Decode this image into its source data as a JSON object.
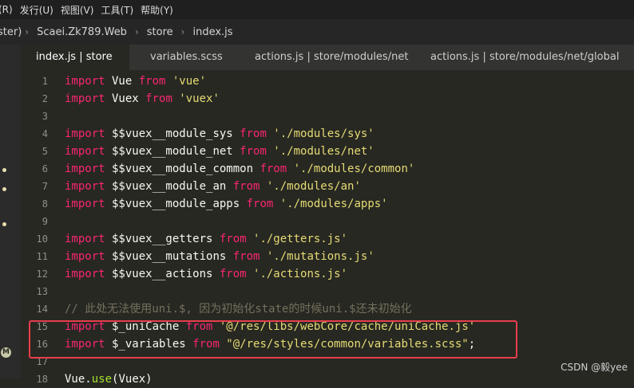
{
  "menu": [
    "(R)",
    "发行(U)",
    "视图(V)",
    "工具(T)",
    "帮助(Y)"
  ],
  "breadcrumb": [
    "ster)",
    "Scaei.Zk789.Web",
    "store",
    "index.js"
  ],
  "tabs": [
    {
      "label": "index.js | store",
      "active": true
    },
    {
      "label": "variables.scss",
      "active": false
    },
    {
      "label": "actions.js | store/modules/net",
      "active": false
    },
    {
      "label": "actions.js | store/modules/net/global",
      "active": false
    }
  ],
  "code": [
    {
      "n": "1",
      "tokens": [
        {
          "t": "import",
          "c": "kw"
        },
        {
          "t": " Vue ",
          "c": ""
        },
        {
          "t": "from",
          "c": "kw"
        },
        {
          "t": " 'vue'",
          "c": "str"
        }
      ]
    },
    {
      "n": "2",
      "tokens": [
        {
          "t": "import",
          "c": "kw"
        },
        {
          "t": " Vuex ",
          "c": ""
        },
        {
          "t": "from",
          "c": "kw"
        },
        {
          "t": " 'vuex'",
          "c": "str"
        }
      ]
    },
    {
      "n": "3",
      "tokens": []
    },
    {
      "n": "4",
      "tokens": [
        {
          "t": "import",
          "c": "kw"
        },
        {
          "t": " $$vuex__module_sys ",
          "c": ""
        },
        {
          "t": "from",
          "c": "kw"
        },
        {
          "t": " './modules/sys'",
          "c": "str"
        }
      ]
    },
    {
      "n": "5",
      "tokens": [
        {
          "t": "import",
          "c": "kw"
        },
        {
          "t": " $$vuex__module_net ",
          "c": ""
        },
        {
          "t": "from",
          "c": "kw"
        },
        {
          "t": " './modules/net'",
          "c": "str"
        }
      ]
    },
    {
      "n": "6",
      "tokens": [
        {
          "t": "import",
          "c": "kw"
        },
        {
          "t": " $$vuex__module_common ",
          "c": ""
        },
        {
          "t": "from",
          "c": "kw"
        },
        {
          "t": " './modules/common'",
          "c": "str"
        }
      ]
    },
    {
      "n": "7",
      "tokens": [
        {
          "t": "import",
          "c": "kw"
        },
        {
          "t": " $$vuex__module_an ",
          "c": ""
        },
        {
          "t": "from",
          "c": "kw"
        },
        {
          "t": " './modules/an'",
          "c": "str"
        }
      ]
    },
    {
      "n": "8",
      "tokens": [
        {
          "t": "import",
          "c": "kw"
        },
        {
          "t": " $$vuex__module_apps ",
          "c": ""
        },
        {
          "t": "from",
          "c": "kw"
        },
        {
          "t": " './modules/apps'",
          "c": "str"
        }
      ]
    },
    {
      "n": "9",
      "tokens": []
    },
    {
      "n": "10",
      "tokens": [
        {
          "t": "import",
          "c": "kw"
        },
        {
          "t": " $$vuex__getters ",
          "c": ""
        },
        {
          "t": "from",
          "c": "kw"
        },
        {
          "t": " './getters.js'",
          "c": "str"
        }
      ]
    },
    {
      "n": "11",
      "tokens": [
        {
          "t": "import",
          "c": "kw"
        },
        {
          "t": " $$vuex__mutations ",
          "c": ""
        },
        {
          "t": "from",
          "c": "kw"
        },
        {
          "t": " './mutations.js'",
          "c": "str"
        }
      ]
    },
    {
      "n": "12",
      "tokens": [
        {
          "t": "import",
          "c": "kw"
        },
        {
          "t": " $$vuex__actions ",
          "c": ""
        },
        {
          "t": "from",
          "c": "kw"
        },
        {
          "t": " './actions.js'",
          "c": "str"
        }
      ]
    },
    {
      "n": "13",
      "tokens": []
    },
    {
      "n": "14",
      "tokens": [
        {
          "t": "// 此处无法使用uni.$, 因为初始化state的时候uni.$还未初始化",
          "c": "cm"
        }
      ]
    },
    {
      "n": "15",
      "tokens": [
        {
          "t": "import",
          "c": "kw"
        },
        {
          "t": " $_uniCache ",
          "c": ""
        },
        {
          "t": "from",
          "c": "kw"
        },
        {
          "t": " '@/res/libs/webCore/cache/uniCache.js'",
          "c": "str"
        }
      ]
    },
    {
      "n": "16",
      "tokens": [
        {
          "t": "import",
          "c": "kw"
        },
        {
          "t": " $_variables ",
          "c": ""
        },
        {
          "t": "from",
          "c": "kw"
        },
        {
          "t": " \"@/res/styles/common/variables.scss\"",
          "c": "str"
        },
        {
          "t": ";",
          "c": ""
        }
      ]
    },
    {
      "n": "17",
      "tokens": []
    },
    {
      "n": "18",
      "tokens": [
        {
          "t": "Vue",
          "c": ""
        },
        {
          "t": ".",
          "c": ""
        },
        {
          "t": "use",
          "c": "call"
        },
        {
          "t": "(Vuex)",
          "c": ""
        }
      ]
    }
  ],
  "gutter_badge": "M",
  "watermark": "CSDN @毅yee"
}
